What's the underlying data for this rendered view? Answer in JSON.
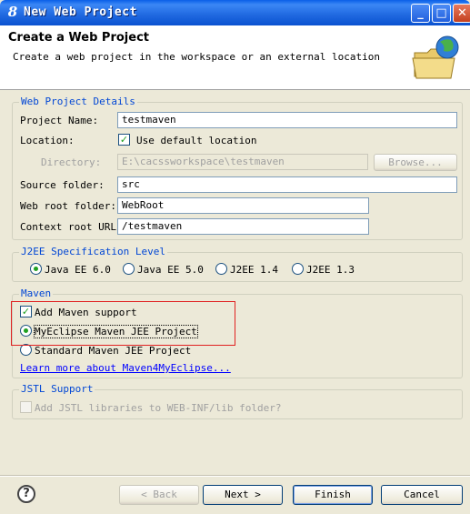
{
  "window": {
    "title": "New Web Project",
    "controls": [
      "minimize-icon",
      "maximize-icon",
      "close-icon"
    ]
  },
  "header": {
    "title": "Create a Web Project",
    "description": "Create a web project in the workspace or an external location",
    "icon": "folder-globe-icon"
  },
  "details": {
    "group_label": "Web Project Details",
    "project_name_label": "Project Name:",
    "project_name_value": "testmaven",
    "location_label": "Location:",
    "use_default_location_label": "Use default location",
    "use_default_location_checked": true,
    "directory_label": "Directory:",
    "directory_value": "E:\\cacssworkspace\\testmaven",
    "browse_label": "Browse...",
    "source_folder_label": "Source folder:",
    "source_folder_value": "src",
    "web_root_label": "Web root folder:",
    "web_root_value": "WebRoot",
    "context_root_label": "Context root URL:",
    "context_root_value": "/testmaven"
  },
  "j2ee": {
    "group_label": "J2EE Specification Level",
    "options": [
      "Java EE 6.0",
      "Java EE 5.0",
      "J2EE 1.4",
      "J2EE 1.3"
    ],
    "selected": "Java EE 6.0"
  },
  "maven": {
    "group_label": "Maven",
    "add_support_label": "Add Maven support",
    "add_support_checked": true,
    "myeclipse_label": "MyEclipse Maven JEE Project",
    "standard_label": "Standard Maven JEE Project",
    "selected": "MyEclipse Maven JEE Project",
    "learn_more_link": "Learn more about Maven4MyEclipse..."
  },
  "jstl": {
    "group_label": "JSTL Support",
    "add_jstl_label": "Add JSTL libraries to WEB-INF/lib folder?",
    "add_jstl_checked": false
  },
  "footer": {
    "help_label": "?",
    "back_label": "< Back",
    "next_label": "Next >",
    "finish_label": "Finish",
    "cancel_label": "Cancel"
  },
  "colors": {
    "title_bar": "#0a5fe8",
    "group_label": "#0046d5",
    "highlight_box": "#e02020",
    "link": "#0000ff"
  }
}
